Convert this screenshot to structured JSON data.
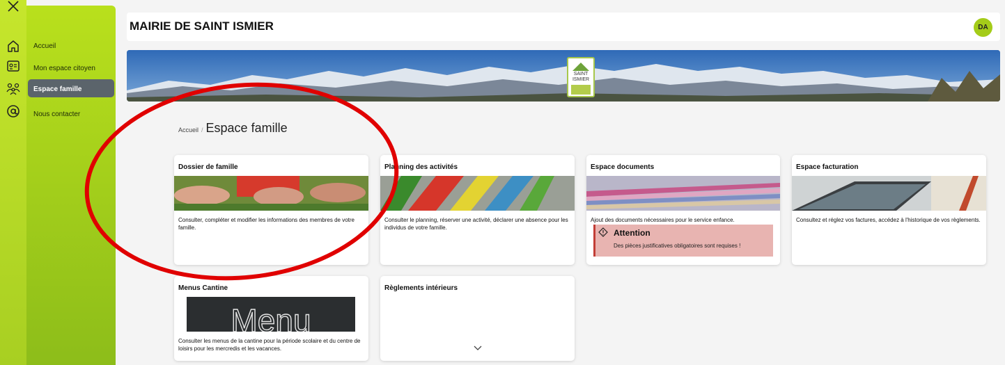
{
  "sidebar": {
    "items": [
      {
        "label": "Accueil",
        "icon": "home-icon"
      },
      {
        "label": "Mon espace citoyen",
        "icon": "id-card-icon"
      },
      {
        "label": "Espace famille",
        "icon": "family-icon",
        "active": true
      },
      {
        "label": "Nous contacter",
        "icon": "at-sign-icon"
      }
    ],
    "close_icon": "close-icon"
  },
  "header": {
    "title": "MAIRIE DE SAINT ISMIER",
    "avatar_initials": "DA"
  },
  "banner": {
    "logo_line1": "SAINT",
    "logo_line2": "ISMIER"
  },
  "breadcrumb": {
    "home": "Accueil",
    "separator": "/",
    "current": "Espace famille"
  },
  "cards": [
    {
      "title": "Dossier de famille",
      "description": "Consulter, compléter et modifier les informations des membres de votre famille."
    },
    {
      "title": "Planning des activités",
      "description": "Consulter le planning, réserver une activité, déclarer une absence pour les individus de votre famille."
    },
    {
      "title": "Espace documents",
      "description": "Ajout des documents nécessaires pour le service enfance.",
      "alert": {
        "title": "Attention",
        "text": "Des pièces justificatives obligatoires sont requises !"
      }
    },
    {
      "title": "Espace facturation",
      "description": "Consultez et réglez vos factures, accédez à l'historique de vos règlements."
    },
    {
      "title": "Menus Cantine",
      "description": "Consulter les menus de la cantine pour la période scolaire et du centre de loisirs pour les mercredis et les vacances.",
      "image_text": "Menu"
    },
    {
      "title": "Règlements intérieurs",
      "description": ""
    }
  ],
  "colors": {
    "brand_green": "#a8cf22",
    "active_item": "#5b646b",
    "alert_bg": "#e8b4b1",
    "alert_border": "#c23d36",
    "annotation_red": "#e00000"
  }
}
